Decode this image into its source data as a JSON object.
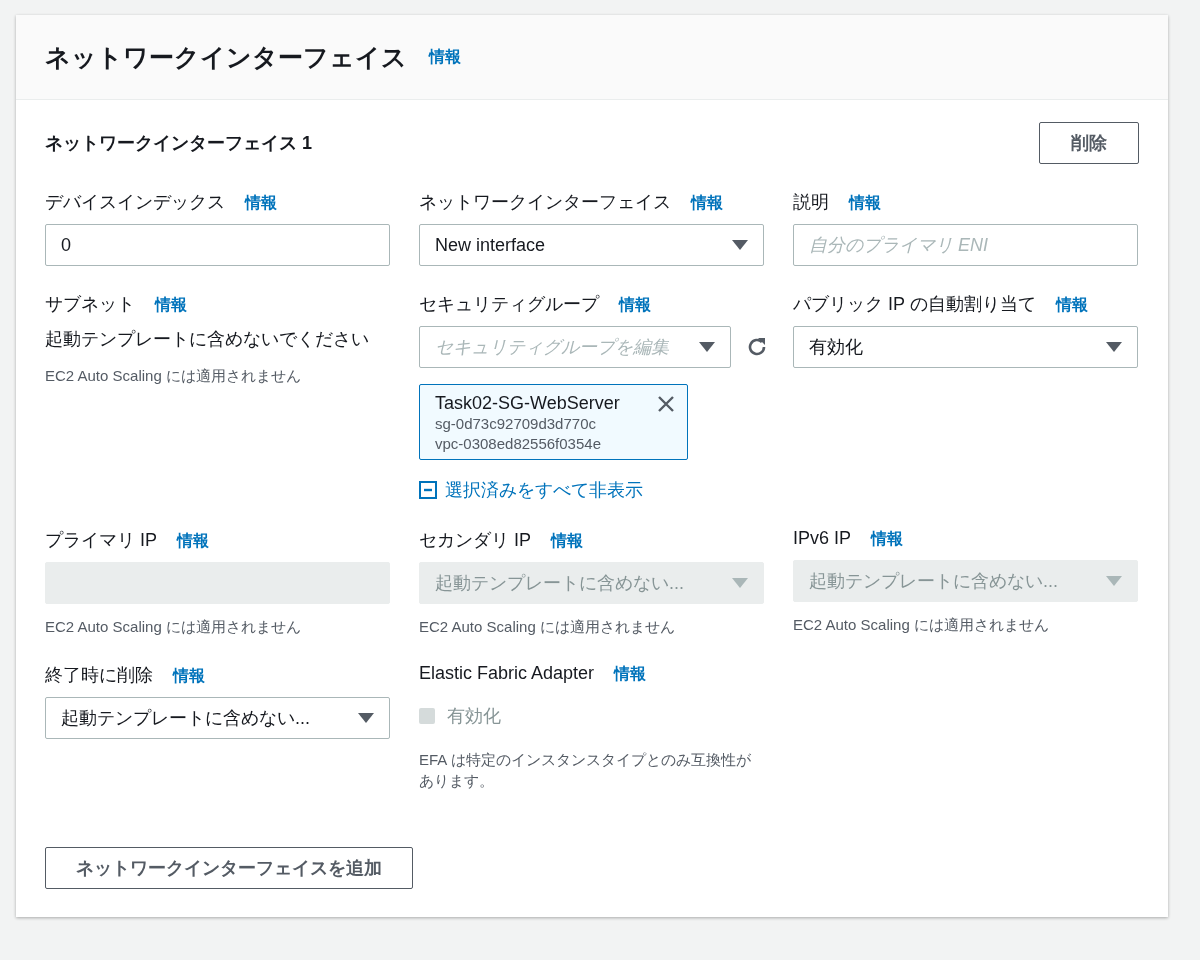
{
  "panel": {
    "title": "ネットワークインターフェイス",
    "info": "情報"
  },
  "interface": {
    "title": "ネットワークインターフェイス 1",
    "delete_button": "削除",
    "fields": [
      {
        "kind": "input",
        "label": "デバイスインデックス",
        "info": "情報",
        "value": "0",
        "disabled": false
      },
      {
        "kind": "select",
        "label": "ネットワークインターフェイス",
        "info": "情報",
        "value": "New interface",
        "disabled": false
      },
      {
        "kind": "input",
        "label": "説明",
        "info": "情報",
        "placeholder": "自分のプライマリ ENI",
        "disabled": false
      },
      {
        "kind": "text",
        "label": "サブネット",
        "info": "情報",
        "text": "起動テンプレートに含めないでください",
        "hint": "EC2 Auto Scaling には適用されません"
      },
      {
        "kind": "multiselect",
        "label": "セキュリティグループ",
        "info": "情報",
        "placeholder": "セキュリティグループを編集",
        "tokens": [
          {
            "name": "Task02-SG-WebServer",
            "lines": [
              "sg-0d73c92709d3d770c",
              "vpc-0308ed82556f0354e"
            ]
          }
        ],
        "hide_link": "選択済みをすべて非表示"
      },
      {
        "kind": "select",
        "label": "パブリック IP の自動割り当て",
        "info": "情報",
        "value": "有効化",
        "disabled": false
      },
      {
        "kind": "input",
        "label": "プライマリ IP",
        "info": "情報",
        "disabled": true,
        "hint": "EC2 Auto Scaling には適用されません"
      },
      {
        "kind": "select",
        "label": "セカンダリ IP",
        "info": "情報",
        "value": "起動テンプレートに含めない...",
        "disabled": true,
        "hint": "EC2 Auto Scaling には適用されません"
      },
      {
        "kind": "select",
        "label": "IPv6 IP",
        "info": "情報",
        "value": "起動テンプレートに含めない...",
        "disabled": true,
        "hint": "EC2 Auto Scaling には適用されません"
      },
      {
        "kind": "select",
        "label": "終了時に削除",
        "info": "情報",
        "value": "起動テンプレートに含めない...",
        "disabled": false
      },
      {
        "kind": "checkbox",
        "label": "Elastic Fabric Adapter",
        "info": "情報",
        "option": "有効化",
        "checked": false,
        "disabled": true,
        "hint": "EFA は特定のインスタンスタイプとのみ互換性があります。"
      }
    ]
  },
  "add_button": "ネットワークインターフェイスを追加"
}
